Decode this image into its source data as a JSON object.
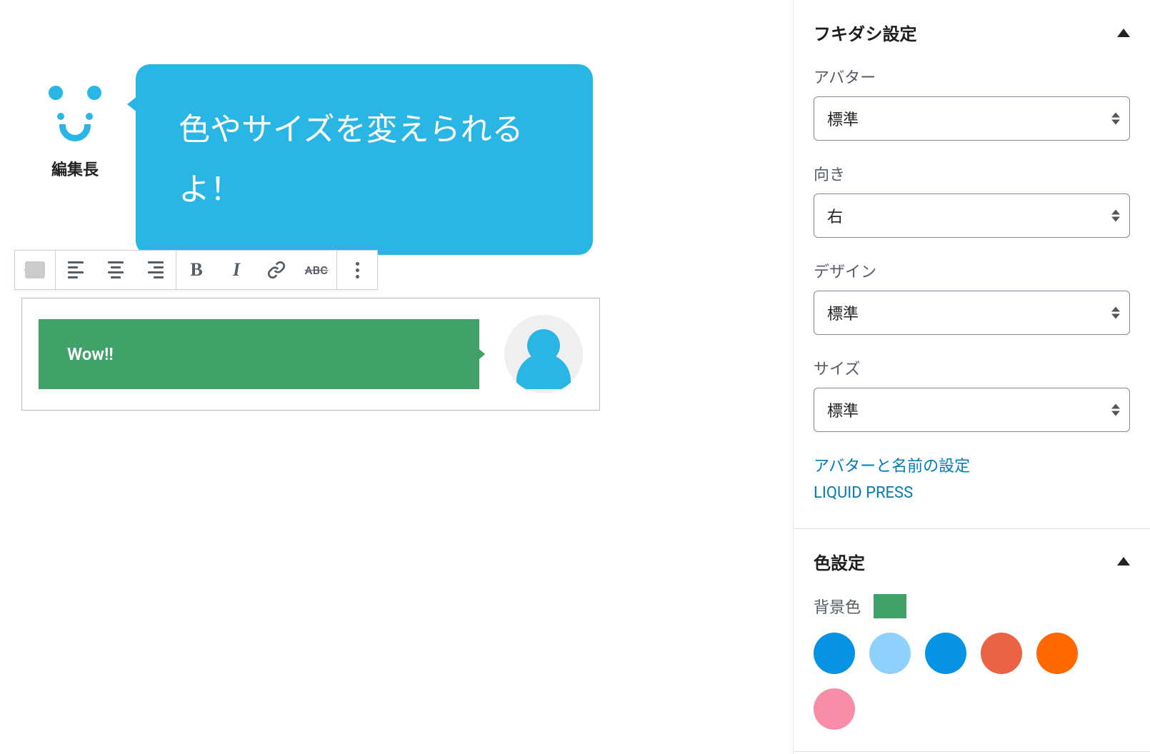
{
  "editor": {
    "bubble1": {
      "avatar_name": "編集長",
      "text": "色やサイズを変えられるよ！"
    },
    "bubble2": {
      "text": "Wow!!"
    },
    "toolbar": {
      "strike_label": "ABC"
    }
  },
  "sidebar": {
    "panel1": {
      "title": "フキダシ設定",
      "fields": {
        "avatar": {
          "label": "アバター",
          "value": "標準"
        },
        "direction": {
          "label": "向き",
          "value": "右"
        },
        "design": {
          "label": "デザイン",
          "value": "標準"
        },
        "size": {
          "label": "サイズ",
          "value": "標準"
        }
      },
      "links": {
        "avatar_settings": "アバターと名前の設定",
        "liquid_press": "LIQUID PRESS"
      }
    },
    "panel2": {
      "title": "色設定",
      "bg_label": "背景色",
      "bg_color": "#40a269",
      "colors": [
        "#0693e3",
        "#8ed1fc",
        "#0693e3",
        "#eb6244",
        "#ff6900",
        "#f78da7"
      ]
    }
  }
}
